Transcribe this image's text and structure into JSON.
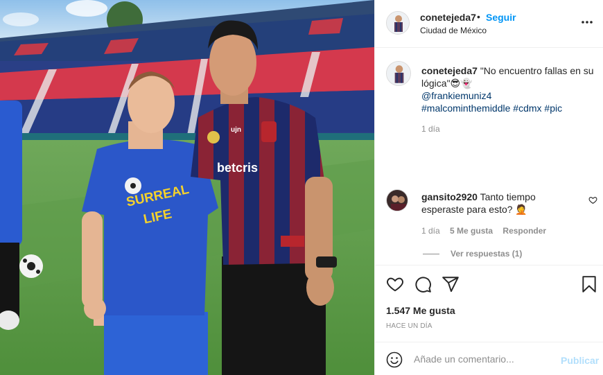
{
  "post": {
    "image_alt": "Two men posing on a soccer field in a stadium"
  },
  "header": {
    "username": "conetejeda7",
    "separator": "•",
    "follow_label": "Seguir",
    "location": "Ciudad de México",
    "more_icon": "more-horizontal-icon"
  },
  "caption": {
    "username": "conetejeda7",
    "text": "\"No encuentro fallas en su lógica\"😎👻",
    "mention": "@frankiemuniz4",
    "hashtags": [
      "#malcominthemiddle",
      "#cdmx",
      "#pic"
    ],
    "time": "1 día"
  },
  "comment": {
    "username": "gansito2920",
    "text": "Tanto tiempo esperaste para esto? 🤦",
    "time": "1 día",
    "likes": "5 Me gusta",
    "reply_label": "Responder",
    "view_replies": "Ver respuestas (1)"
  },
  "actions": {
    "icons": [
      "heart-icon",
      "comment-icon",
      "share-icon",
      "bookmark-icon"
    ],
    "likes_count": "1.547 Me gusta",
    "date": "HACE UN DÍA"
  },
  "add_comment": {
    "placeholder": "Añade un comentario...",
    "publish_label": "Publicar",
    "emoji_icon": "smiley-icon"
  },
  "colors": {
    "accent": "#0095f6",
    "text": "#262626",
    "secondary": "#8e8e8e",
    "link": "#00376b",
    "publish_disabled": "#b2dffc"
  }
}
